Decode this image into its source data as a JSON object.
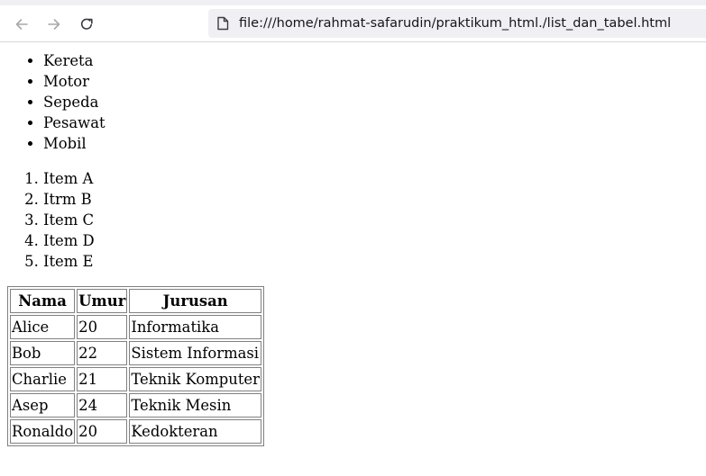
{
  "browser": {
    "url": "file:///home/rahmat-safarudin/praktikum_html./list_dan_tabel.html",
    "icons": {
      "back": "arrow-left-icon",
      "forward": "arrow-right-icon",
      "reload": "reload-icon",
      "page": "page-icon"
    }
  },
  "unordered_list": [
    "Kereta",
    "Motor",
    "Sepeda",
    "Pesawat",
    "Mobil"
  ],
  "ordered_list": [
    "Item A",
    "Itrm B",
    "Item C",
    "Item D",
    "Item E"
  ],
  "table": {
    "headers": [
      "Nama",
      "Umur",
      "Jurusan"
    ],
    "rows": [
      [
        "Alice",
        "20",
        "Informatika"
      ],
      [
        "Bob",
        "22",
        "Sistem Informasi"
      ],
      [
        "Charlie",
        "21",
        "Teknik Komputer"
      ],
      [
        "Asep",
        "24",
        "Teknik Mesin"
      ],
      [
        "Ronaldo",
        "20",
        "Kedokteran"
      ]
    ]
  }
}
